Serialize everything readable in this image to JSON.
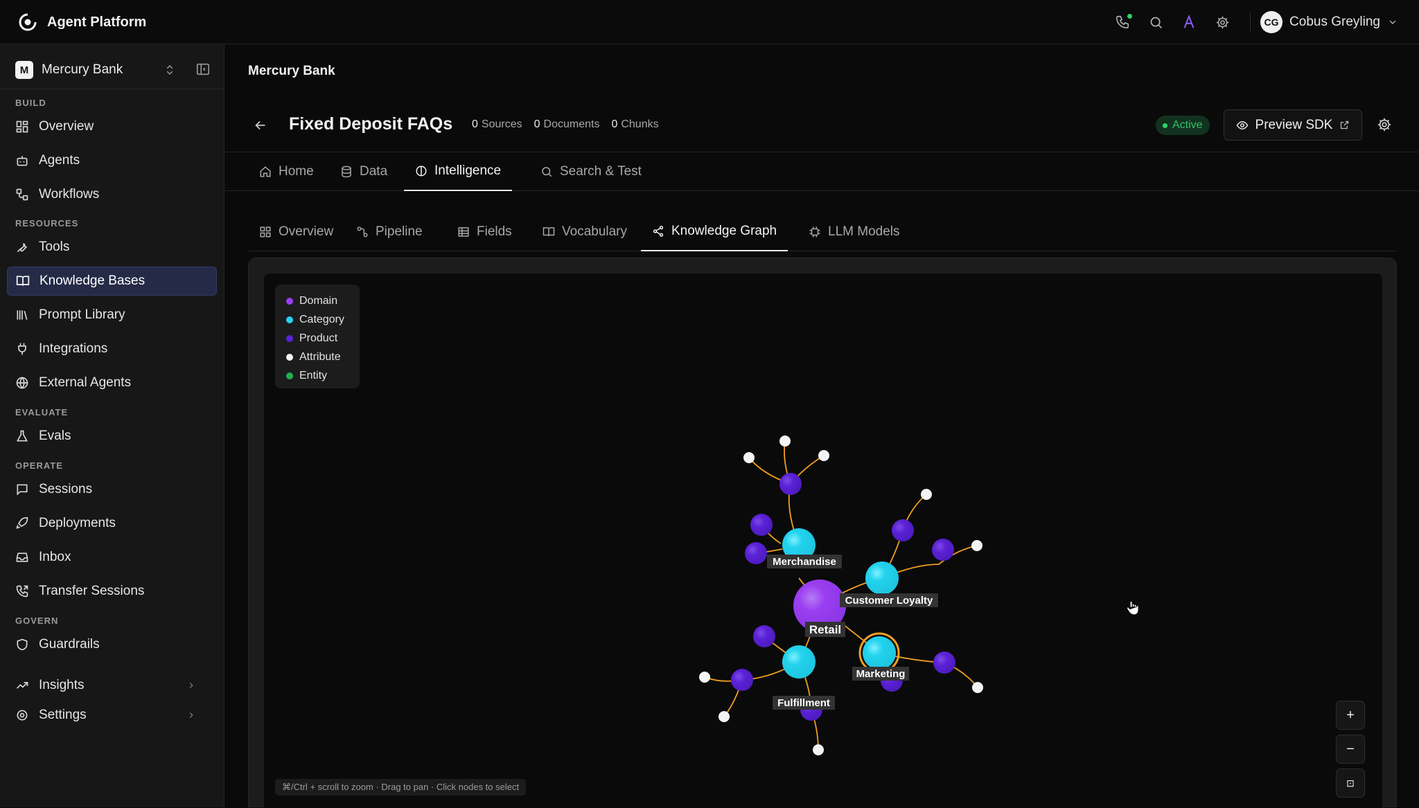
{
  "app": {
    "title": "Agent Platform"
  },
  "user": {
    "initials": "CG",
    "name": "Cobus Greyling"
  },
  "workspace": {
    "badge": "M",
    "name": "Mercury Bank"
  },
  "sidebar": {
    "sections": {
      "build": "BUILD",
      "resources": "RESOURCES",
      "evaluate": "EVALUATE",
      "operate": "OPERATE",
      "govern": "GOVERN"
    },
    "items": {
      "overview": "Overview",
      "agents": "Agents",
      "workflows": "Workflows",
      "tools": "Tools",
      "knowledge_bases": "Knowledge Bases",
      "prompt_library": "Prompt Library",
      "integrations": "Integrations",
      "external_agents": "External Agents",
      "evals": "Evals",
      "sessions": "Sessions",
      "deployments": "Deployments",
      "inbox": "Inbox",
      "transfer_sessions": "Transfer Sessions",
      "guardrails": "Guardrails",
      "insights": "Insights",
      "settings": "Settings"
    }
  },
  "header": {
    "breadcrumb": "Mercury Bank",
    "title": "Fixed Deposit FAQs",
    "stats": {
      "sources": "0",
      "sources_label": "Sources",
      "documents": "0",
      "documents_label": "Documents",
      "chunks": "0",
      "chunks_label": "Chunks"
    },
    "status": "Active",
    "preview_label": "Preview SDK"
  },
  "tabs": {
    "home": "Home",
    "data": "Data",
    "intelligence": "Intelligence",
    "search_test": "Search & Test"
  },
  "subtabs": {
    "overview": "Overview",
    "pipeline": "Pipeline",
    "fields": "Fields",
    "vocabulary": "Vocabulary",
    "knowledge_graph": "Knowledge Graph",
    "llm_models": "LLM Models"
  },
  "legend": [
    {
      "label": "Domain",
      "color": "#9b3ff0"
    },
    {
      "label": "Category",
      "color": "#22d3ee"
    },
    {
      "label": "Product",
      "color": "#5b21d6"
    },
    {
      "label": "Attribute",
      "color": "#f4f4f4"
    },
    {
      "label": "Entity",
      "color": "#22b14c"
    }
  ],
  "graph": {
    "edge_color": "#f0a020",
    "labels": {
      "retail": "Retail",
      "merchandise": "Merchandise",
      "customer_loyalty": "Customer Loyalty",
      "marketing": "Marketing",
      "fulfillment": "Fulfillment"
    },
    "hint": "⌘/Ctrl + scroll to zoom · Drag to pan · Click nodes to select",
    "zoom_in": "+",
    "zoom_out": "−",
    "fit": "⊡"
  }
}
